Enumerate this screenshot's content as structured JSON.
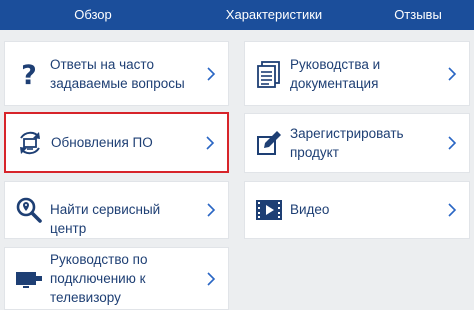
{
  "nav": {
    "tabs": [
      {
        "label": "Обзор"
      },
      {
        "label": "Характеристики"
      },
      {
        "label": "Отзывы"
      }
    ]
  },
  "cards": {
    "faq": {
      "icon": "question-icon",
      "label": "Ответы на часто задаваемые вопросы"
    },
    "update": {
      "icon": "software-update-icon",
      "label": "Обновления ПО",
      "highlighted": true
    },
    "service": {
      "icon": "search-location-icon",
      "label": "Найти сервисный центр"
    },
    "tv": {
      "icon": "tv-connection-icon",
      "label": "Руководство по подключению к телевизору"
    },
    "docs": {
      "icon": "documents-icon",
      "label": "Руководства и документация"
    },
    "register": {
      "icon": "register-product-icon",
      "label": "Зарегистрировать продукт"
    },
    "video": {
      "icon": "video-icon",
      "label": "Видео"
    }
  },
  "colors": {
    "nav_bg": "#1b4e9b",
    "icon": "#1e3f74",
    "chevron": "#2a66c4",
    "highlight_border": "#d7242a"
  }
}
